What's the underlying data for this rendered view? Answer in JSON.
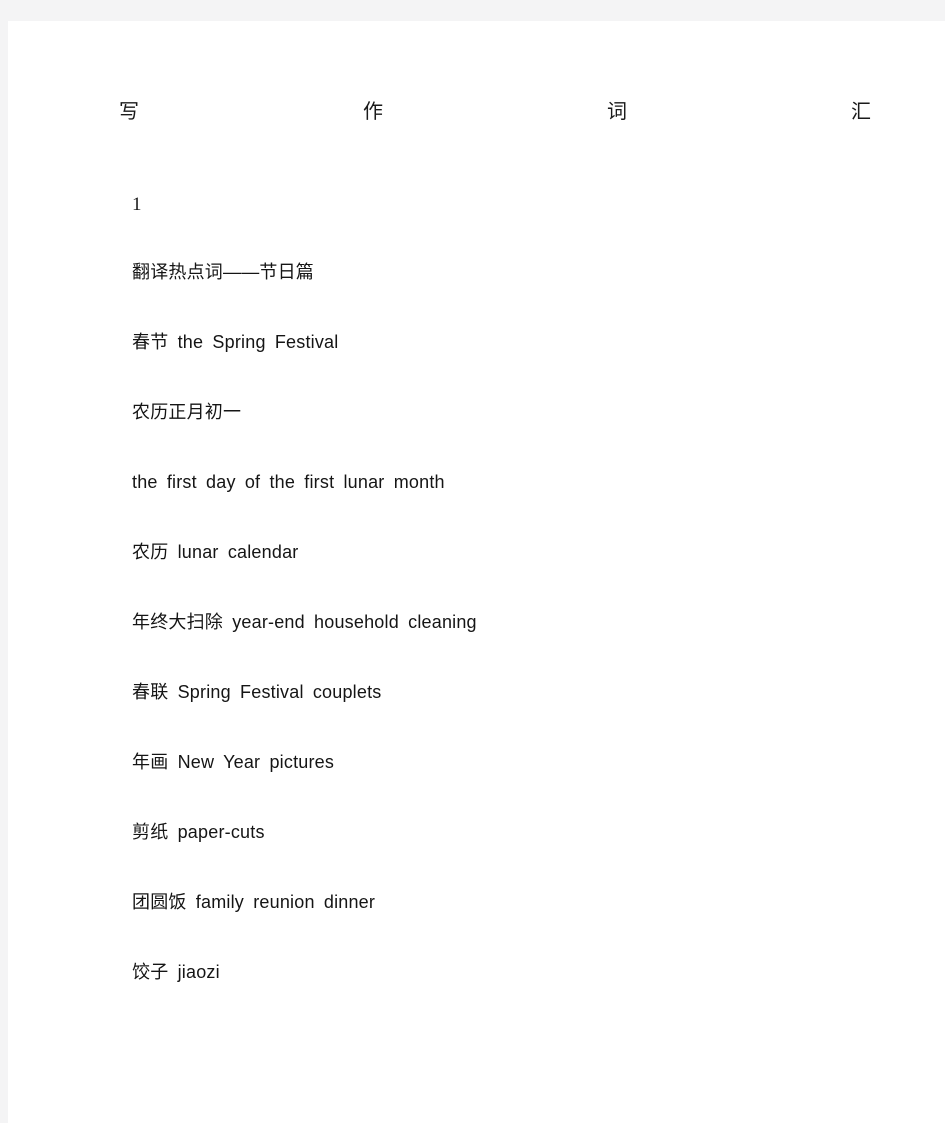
{
  "document": {
    "title_chars": [
      "写",
      "作",
      "词",
      "汇"
    ],
    "title_full": "写作词汇",
    "page_number": "1",
    "section_heading": "翻译热点词——节日篇",
    "entries": [
      {
        "line": "春节 the Spring Festival",
        "term": "春节",
        "translation": "the Spring Festival"
      },
      {
        "line": "农历正月初一",
        "term": "农历正月初一",
        "translation": ""
      },
      {
        "line": "the first day of the first lunar month",
        "term": "",
        "translation": "the first day of the first lunar month"
      },
      {
        "line": "农历 lunar calendar",
        "term": "农历",
        "translation": "lunar calendar"
      },
      {
        "line": "年终大扫除 year-end household cleaning",
        "term": "年终大扫除",
        "translation": "year-end household cleaning"
      },
      {
        "line": "春联 Spring Festival couplets",
        "term": "春联",
        "translation": "Spring Festival couplets"
      },
      {
        "line": "年画 New Year pictures",
        "term": "年画",
        "translation": "New Year pictures"
      },
      {
        "line": "剪纸 paper-cuts",
        "term": "剪纸",
        "translation": "paper-cuts"
      },
      {
        "line": "团圆饭 family reunion dinner",
        "term": "团圆饭",
        "translation": "family reunion dinner"
      },
      {
        "line": "饺子 jiaozi",
        "term": "饺子",
        "translation": "jiaozi"
      }
    ]
  },
  "colors": {
    "page_background": "#ffffff",
    "gutter_background": "#f4f4f5",
    "text": "#151515"
  }
}
